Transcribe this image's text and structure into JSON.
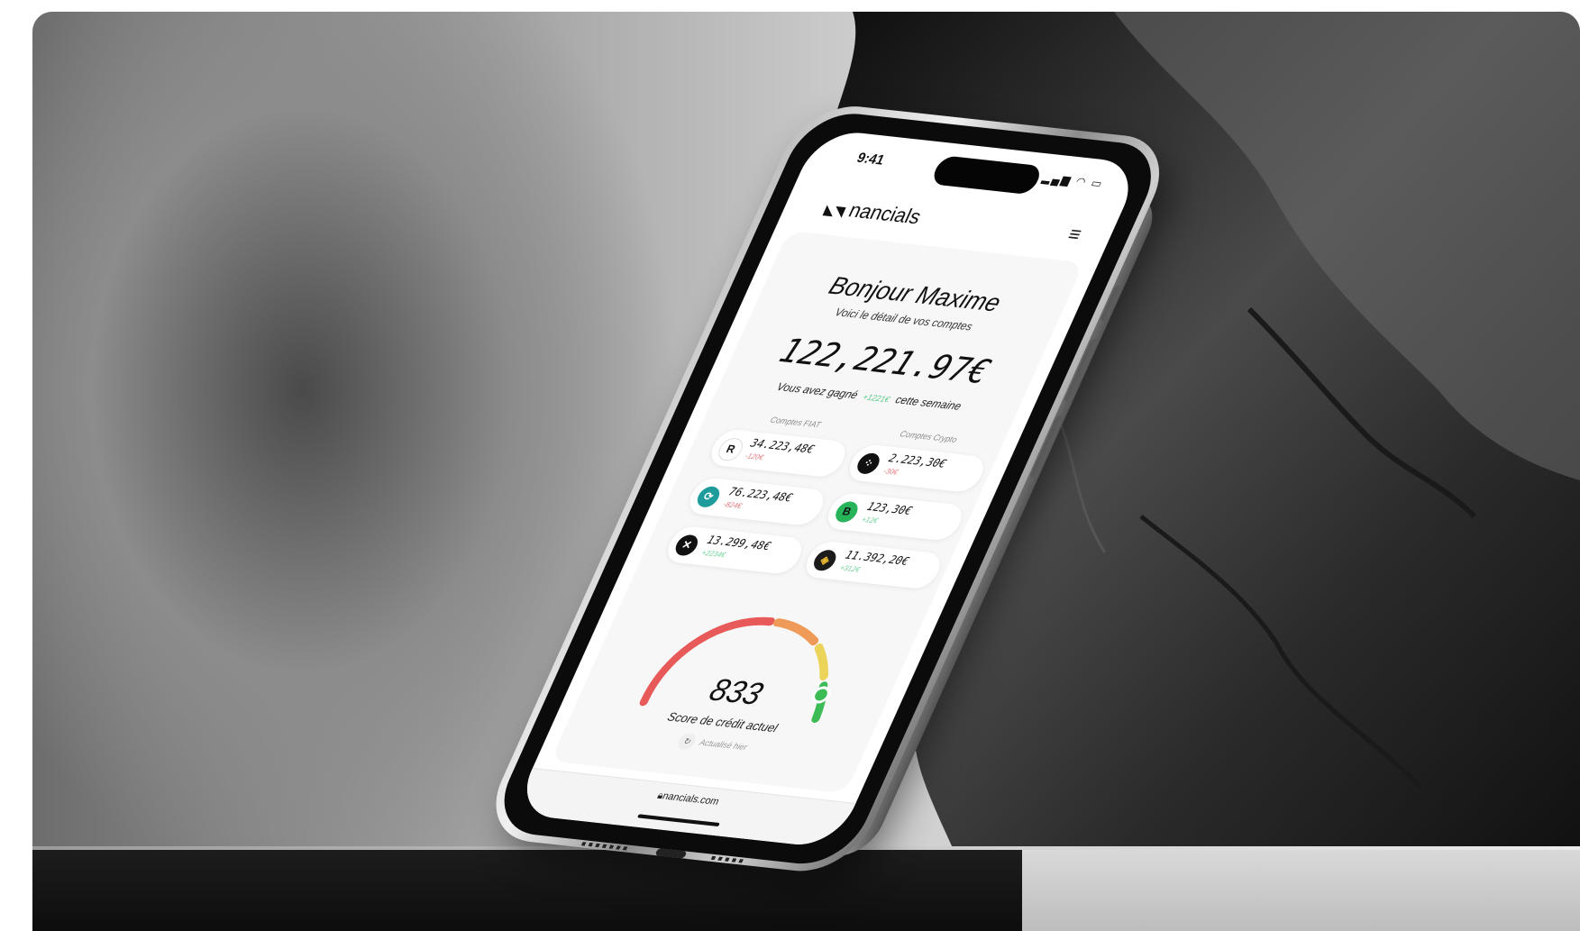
{
  "status_bar": {
    "time": "9:41",
    "icons": "signal wifi battery"
  },
  "app": {
    "brand": "nancials",
    "logo_glyph": "◣◥",
    "menu_glyph": "≡"
  },
  "greeting": {
    "title": "Bonjour Maxime",
    "subtitle": "Voici le détail de vos comptes"
  },
  "balance": {
    "total": "122,221.97€",
    "gain_prefix": "Vous avez gagné",
    "gain_value": "+1221€",
    "gain_suffix": "cette semaine"
  },
  "columns": {
    "fiat": "Comptes FIAT",
    "crypto": "Comptes Crypto"
  },
  "fiat_accounts": [
    {
      "icon": "revolut-icon",
      "glyph": "R",
      "color": "#ffffff",
      "amount": "34.223,48€",
      "change": "-120€",
      "trend": "neg"
    },
    {
      "icon": "bank-icon",
      "glyph": "⟳",
      "color": "#1e9c9c",
      "amount": "76.223,48€",
      "change": "-824€",
      "trend": "neg"
    },
    {
      "icon": "xcross-icon",
      "glyph": "✕",
      "color": "#111111",
      "amount": "13.299,48€",
      "change": "+2234€",
      "trend": "pos"
    }
  ],
  "crypto_accounts": [
    {
      "icon": "dots-icon",
      "glyph": "⁘",
      "color": "#111111",
      "amount": "2.223,30€",
      "change": "-30€",
      "trend": "neg"
    },
    {
      "icon": "bitcoin-icon",
      "glyph": "B",
      "color": "#27b35a",
      "amount": "123,30€",
      "change": "+12€",
      "trend": "pos"
    },
    {
      "icon": "binance-icon",
      "glyph": "◈",
      "color": "#1b1b1b",
      "amount": "11.392,20€",
      "change": "+312€",
      "trend": "pos"
    }
  ],
  "credit": {
    "score": "833",
    "label": "Score de crédit actuel",
    "refresh": "Actualisé hier"
  },
  "browser": {
    "url": "nancials.com"
  },
  "colors": {
    "gauge_red": "#e85a5a",
    "gauge_orange": "#ef9a58",
    "gauge_yellow": "#ecd45a",
    "gauge_green": "#3dbb57"
  }
}
